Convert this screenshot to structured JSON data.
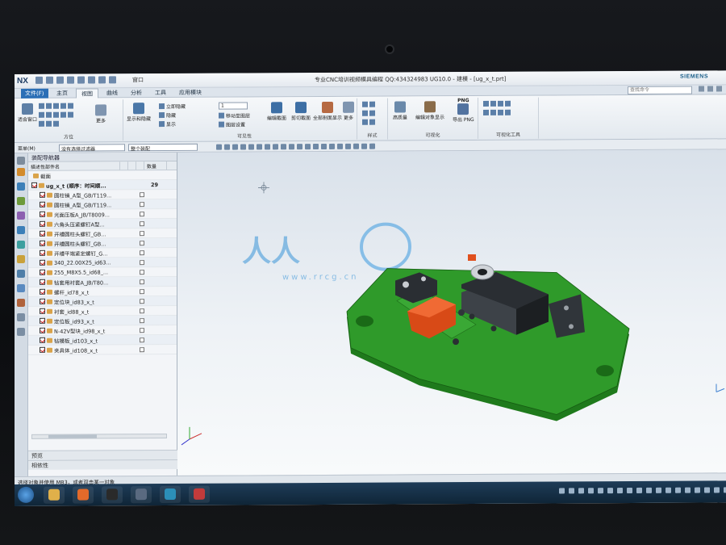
{
  "app": {
    "logo": "NX",
    "window_button": "窗口",
    "title": "专业CNC培训视频模具编程 QQ:434324983 UG10.0 - 建模 - [ug_x_t.prt]",
    "brand": "SIEMENS"
  },
  "menu": {
    "file": "文件(F)",
    "tabs": [
      "主页",
      "视图",
      "曲线",
      "分析",
      "工具",
      "应用模块"
    ],
    "active_tab": "视图",
    "search_placeholder": "查找命令"
  },
  "ribbon": {
    "groups": {
      "orient": {
        "label": "方位",
        "btn_fit": "适合窗口",
        "btn_more": "更多"
      },
      "visibility": {
        "label": "可见性",
        "btn_show_hide": "显示和隐藏",
        "items": [
          "立即隐藏",
          "隐藏",
          "显示"
        ],
        "layer_value": "1",
        "move_to_layer": "移动至图层",
        "layer_settings": "图层设置",
        "edit_section": "编辑截面",
        "clip_section": "剪切截面",
        "section_display": "全部剖面显示",
        "more": "更多"
      },
      "style": {
        "label": "样式"
      },
      "visual": {
        "label": "可视化",
        "btn_hd": "高质量",
        "btn_edit_obj": "编辑对象显示",
        "btn_png": "导出 PNG",
        "png_tag": "PNG"
      },
      "prefs": {
        "label": "可视化工具"
      }
    }
  },
  "selbar": {
    "menu_label": "菜单(M)",
    "filter": "没有选择过滤器",
    "scope": "整个装配"
  },
  "navigator": {
    "title": "装配导航器",
    "columns": {
      "name": "描述性部件名",
      "qty": "数量"
    },
    "section": "截面",
    "root": {
      "name": "ug_x_t (顺序：时间顺...",
      "qty": "29"
    },
    "items": [
      "圆柱销_A型_GB/T119...",
      "圆柱销_A型_GB/T119...",
      "光面压板A_JB/T8009...",
      "六角头压紧螺钉A型...",
      "开槽圆柱头螺钉_GB...",
      "开槽圆柱头螺钉_GB...",
      "开槽平端紧定螺钉_G...",
      "340_22.00X25_id63...",
      "255_M8X5.5_id68_...",
      "钻套用衬套A_JB/T80...",
      "螺杆_id78_x_t",
      "定位块_id83_x_t",
      "衬套_id88_x_t",
      "定位板_id93_x_t",
      "N-42V型块_id98_x_t",
      "钻模板_id103_x_t",
      "夹具体_id108_x_t"
    ],
    "panel_preview": "预览",
    "panel_dependencies": "相依性"
  },
  "status": {
    "text": "选择对象并使用 MB3，或者双击某一对象"
  },
  "watermark": {
    "text": "人人",
    "url": "www.rrcg.cn"
  },
  "colors": {
    "base_plate": "#2f9a2a",
    "clamp_body": "#2a2e33",
    "v_block": "#e0501e",
    "ribbon_accent": "#2b6fb6"
  }
}
